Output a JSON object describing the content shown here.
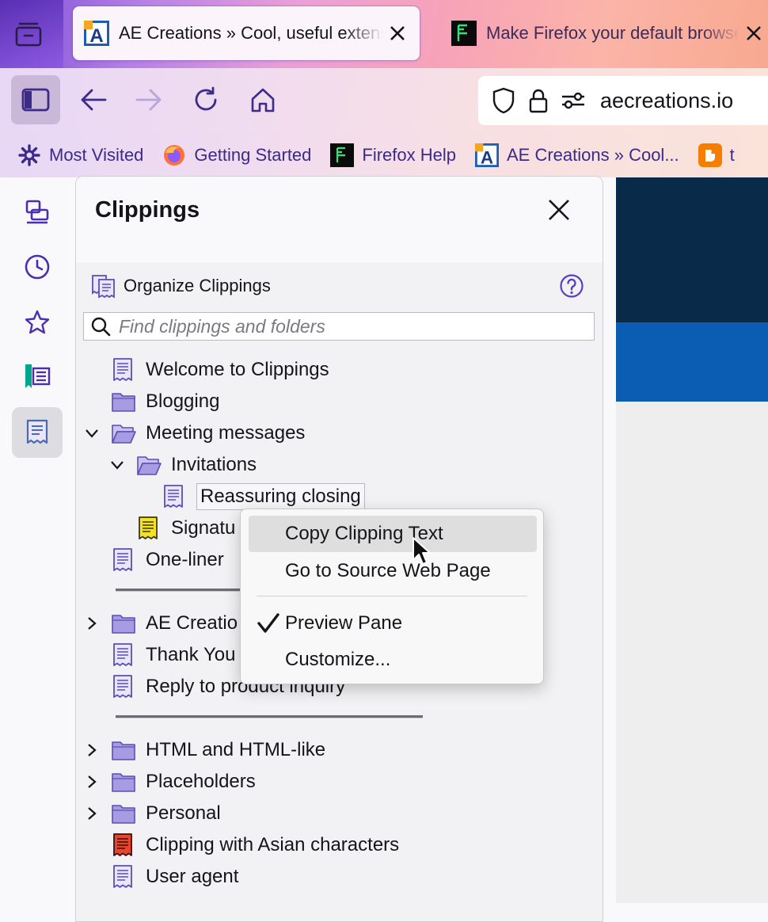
{
  "tabs": [
    {
      "title": "AE Creations » Cool, useful extensions",
      "active": true
    },
    {
      "title": "Make Firefox your default browser",
      "active": false
    }
  ],
  "urlbar": {
    "url": "aecreations.io"
  },
  "bookmarks": [
    {
      "label": "Most Visited",
      "icon": "gear-icon"
    },
    {
      "label": "Getting Started",
      "icon": "firefox-icon"
    },
    {
      "label": "Firefox Help",
      "icon": "firefox-help-icon"
    },
    {
      "label": "AE Creations » Cool...",
      "icon": "ae-creations-icon"
    },
    {
      "label": "t",
      "icon": "blogger-icon"
    }
  ],
  "panel": {
    "title": "Clippings",
    "organize_label": "Organize Clippings",
    "search_placeholder": "Find clippings and folders"
  },
  "tree": [
    {
      "label": "Welcome to Clippings",
      "type": "clipping"
    },
    {
      "label": "Blogging",
      "type": "folder"
    },
    {
      "label": "Meeting messages",
      "type": "folder-open"
    },
    {
      "label": "Invitations",
      "type": "folder-open"
    },
    {
      "label": "Reassuring closing",
      "type": "clipping"
    },
    {
      "label": "Signatu",
      "type": "clipping-yellow"
    },
    {
      "label": "One-liner",
      "type": "clipping"
    },
    {
      "label": "AE Creatio",
      "type": "folder"
    },
    {
      "label": "Thank You",
      "type": "clipping"
    },
    {
      "label": "Reply to product inquiry",
      "type": "clipping"
    },
    {
      "label": "HTML and HTML-like",
      "type": "folder"
    },
    {
      "label": "Placeholders",
      "type": "folder"
    },
    {
      "label": "Personal",
      "type": "folder"
    },
    {
      "label": "Clipping with Asian characters",
      "type": "clipping-red"
    },
    {
      "label": "User agent",
      "type": "clipping"
    }
  ],
  "context_menu": {
    "items": [
      {
        "label": "Copy Clipping Text"
      },
      {
        "label": "Go to Source Web Page"
      },
      {
        "label": "Preview Pane",
        "checked": true
      },
      {
        "label": "Customize..."
      }
    ]
  },
  "colors": {
    "accent": "#5b3fc4",
    "folder": "#a79be3",
    "clipping_outline": "#5b4fb3",
    "menu_hover": "#dedede",
    "panel_body": "#f2f2f4"
  }
}
